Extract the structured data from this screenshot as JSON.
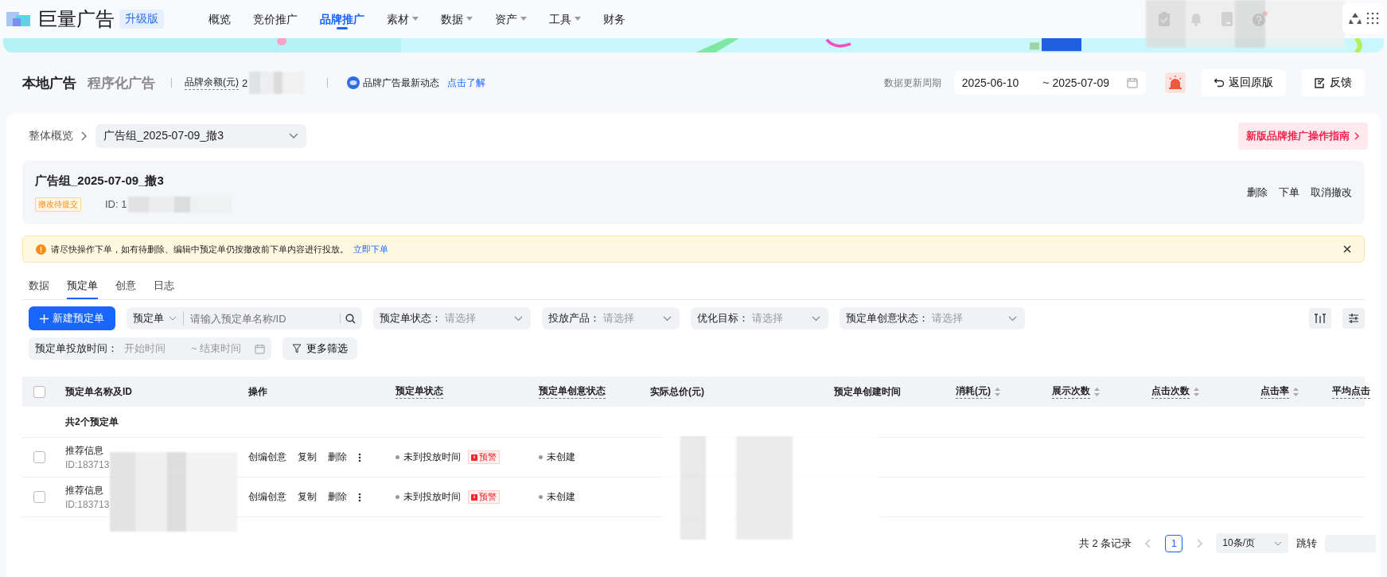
{
  "nav": {
    "logo": "巨量广告",
    "edition": "升级版",
    "items": [
      {
        "label": "概览",
        "selected": false,
        "dropdown": false
      },
      {
        "label": "竞价推广",
        "selected": false,
        "dropdown": false
      },
      {
        "label": "品牌推广",
        "selected": true,
        "dropdown": false
      },
      {
        "label": "素材",
        "selected": false,
        "dropdown": true
      },
      {
        "label": "数据",
        "selected": false,
        "dropdown": true
      },
      {
        "label": "资产",
        "selected": false,
        "dropdown": true
      },
      {
        "label": "工具",
        "selected": false,
        "dropdown": true
      },
      {
        "label": "财务",
        "selected": false,
        "dropdown": false
      }
    ]
  },
  "header": {
    "tabs": [
      {
        "label": "本地广告",
        "selected": true
      },
      {
        "label": "程序化广告",
        "selected": false
      }
    ],
    "balance_label": "品牌余额(元)",
    "balance_value": "2",
    "news_text": "品牌广告最新动态",
    "news_link": "点击了解",
    "period_label": "数据更新周期",
    "start_date": "2025-06-10",
    "end_date": "~ 2025-07-09",
    "buttons": [
      "返回原版",
      "反馈"
    ]
  },
  "breadcrumb": {
    "root": "整体概览",
    "selector": "广告组_2025-07-09_撤3"
  },
  "guide_link": "新版品牌推广操作指南",
  "group": {
    "title": "广告组_2025-07-09_撤3",
    "status": "撤改待提交",
    "id": "ID: 1",
    "actions": [
      "删除",
      "下单",
      "取消撤改"
    ]
  },
  "alert": {
    "text": "请尽快操作下单，如有待删除、编辑中预定单仍按撤改前下单内容进行投放。",
    "link": "立即下单"
  },
  "tabs": [
    {
      "label": "数据",
      "selected": false
    },
    {
      "label": "预定单",
      "selected": true
    },
    {
      "label": "创意",
      "selected": false
    },
    {
      "label": "日志",
      "selected": false
    }
  ],
  "filters": {
    "new_button": "新建预定单",
    "search_type": "预定单",
    "search_placeholder": "请输入预定单名称/ID",
    "selects": [
      {
        "label": "预定单状态：",
        "placeholder": "请选择"
      },
      {
        "label": "投放产品：",
        "placeholder": "请选择"
      },
      {
        "label": "优化目标：",
        "placeholder": "请选择"
      },
      {
        "label": "预定单创意状态：",
        "placeholder": "请选择"
      }
    ],
    "date_label": "预定单投放时间：",
    "date_start": "开始时间",
    "date_end": "~ 结束时间",
    "more": "更多筛选"
  },
  "table": {
    "columns": [
      {
        "label": "预定单名称及ID",
        "sortable": false,
        "underlined": false
      },
      {
        "label": "操作",
        "sortable": false,
        "underlined": false
      },
      {
        "label": "预定单状态",
        "sortable": false,
        "underlined": true
      },
      {
        "label": "预定单创意状态",
        "sortable": false,
        "underlined": true
      },
      {
        "label": "实际总价(元)",
        "sortable": false,
        "underlined": false
      },
      {
        "label": "预定单创建时间",
        "sortable": false,
        "underlined": false
      },
      {
        "label": "消耗(元)",
        "sortable": true,
        "underlined": true
      },
      {
        "label": "展示次数",
        "sortable": true,
        "underlined": true
      },
      {
        "label": "点击次数",
        "sortable": true,
        "underlined": true
      },
      {
        "label": "点击率",
        "sortable": true,
        "underlined": true
      },
      {
        "label": "平均点击",
        "sortable": false,
        "underlined": true
      }
    ],
    "select_all_checked": false,
    "summary": "共2个预定单",
    "rows": [
      {
        "checked": false,
        "name": "推荐信息",
        "id": "ID:183713",
        "actions": [
          "创编创意",
          "复制",
          "删除"
        ],
        "status": "未到投放时间",
        "warning": "预警",
        "creative_status": "未创建"
      },
      {
        "checked": false,
        "name": "推荐信息",
        "id": "ID:183713",
        "actions": [
          "创编创意",
          "复制",
          "删除"
        ],
        "status": "未到投放时间",
        "warning": "预警",
        "creative_status": "未创建"
      }
    ]
  },
  "pagination": {
    "total": "共 2 条记录",
    "pages": [
      {
        "label": "1",
        "selected": true
      }
    ],
    "page_size": "10条/页",
    "jump": "跳转"
  }
}
